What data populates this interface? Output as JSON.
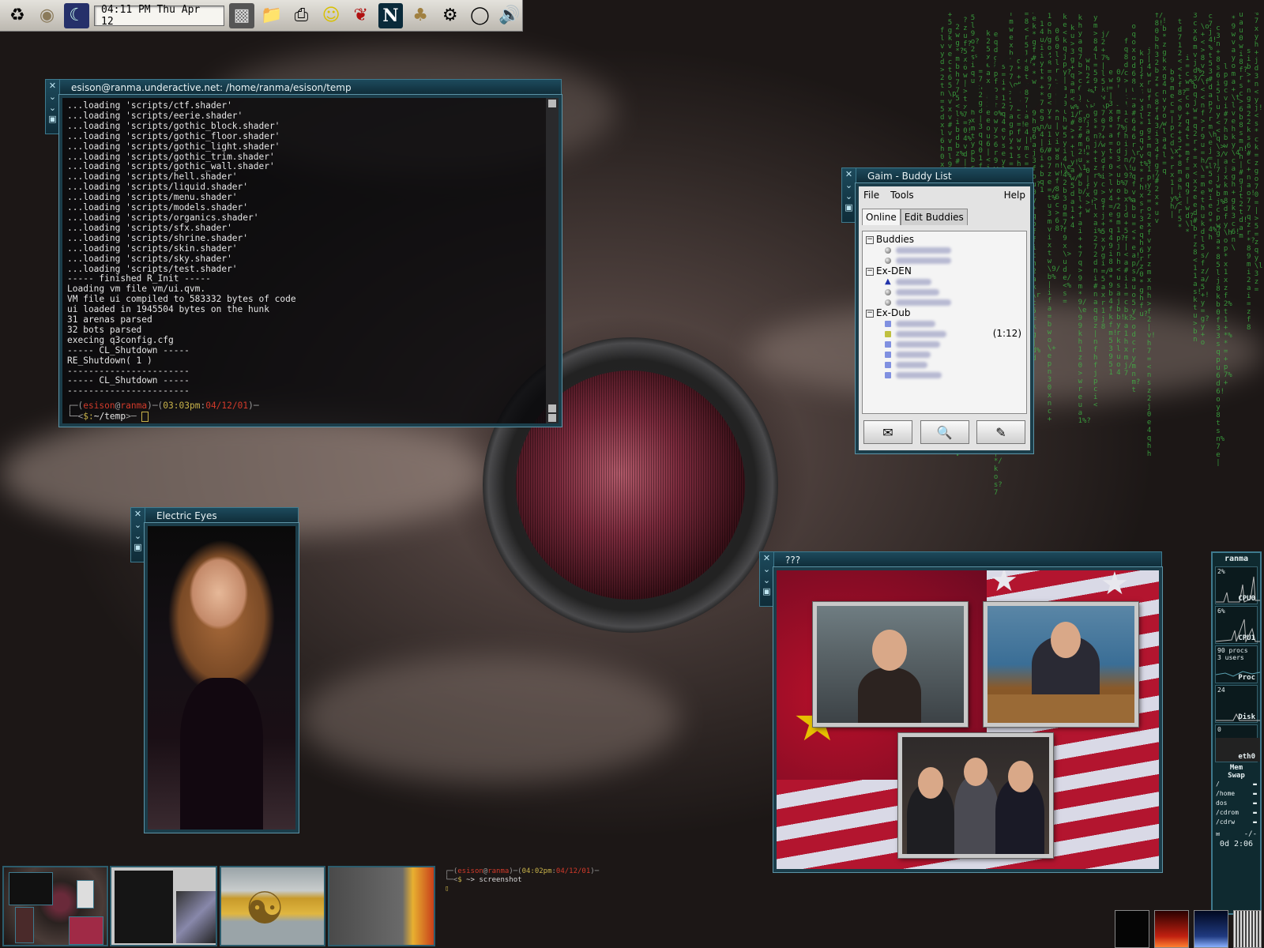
{
  "top_panel": {
    "clock": "04:11 PM Thu Apr 12",
    "icons": [
      "gnome-foot-icon",
      "gecko-icon",
      "display-settings-icon",
      "terminal-icon",
      "file-manager-icon",
      "printer-icon",
      "gnome-emblem-icon",
      "mozilla-icon",
      "netscape-icon",
      "wolf-icon",
      "mixer-icon",
      "cd-player-icon",
      "volume-icon"
    ]
  },
  "terminal": {
    "title": "esison@ranma.underactive.net: /home/ranma/esison/temp",
    "lines": [
      "...loading 'scripts/ctf.shader'",
      "...loading 'scripts/eerie.shader'",
      "...loading 'scripts/gothic_block.shader'",
      "...loading 'scripts/gothic_floor.shader'",
      "...loading 'scripts/gothic_light.shader'",
      "...loading 'scripts/gothic_trim.shader'",
      "...loading 'scripts/gothic_wall.shader'",
      "...loading 'scripts/hell.shader'",
      "...loading 'scripts/liquid.shader'",
      "...loading 'scripts/menu.shader'",
      "...loading 'scripts/models.shader'",
      "...loading 'scripts/organics.shader'",
      "...loading 'scripts/sfx.shader'",
      "...loading 'scripts/shrine.shader'",
      "...loading 'scripts/skin.shader'",
      "...loading 'scripts/sky.shader'",
      "...loading 'scripts/test.shader'",
      "----- finished R_Init -----",
      "Loading vm file vm/ui.qvm.",
      "VM file ui compiled to 583332 bytes of code",
      "ui loaded in 1945504 bytes on the hunk",
      "31 arenas parsed",
      "32 bots parsed",
      "execing q3config.cfg",
      "----- CL_Shutdown -----",
      "RE_Shutdown( 1 )",
      "-----------------------",
      "----- CL_Shutdown -----",
      "-----------------------"
    ],
    "prompt": {
      "user": "esison",
      "host": "ranma",
      "time": "03:03pm",
      "date": "04/12/01",
      "cwd": "~/temp"
    }
  },
  "gaim": {
    "title": "Gaim - Buddy List",
    "menu": {
      "file": "File",
      "tools": "Tools",
      "help": "Help"
    },
    "tabs": {
      "online": "Online",
      "edit": "Edit Buddies"
    },
    "groups": {
      "buddies": "Buddies",
      "exden": "Ex-DEN",
      "exdub": "Ex-Dub"
    },
    "idle": "(1:12)"
  },
  "eyes": {
    "title": "Electric Eyes"
  },
  "video": {
    "title": "???"
  },
  "monitor": {
    "host": "ranma",
    "cpu0_pct": "2%",
    "cpu0": "CPU0",
    "cpu1_pct": "6%",
    "cpu1": "CPU1",
    "procs": "90 procs",
    "users": "3 users",
    "proc": "Proc",
    "proc_val": "24",
    "disk": "Disk",
    "disk_val": "0",
    "net": "eth0",
    "mem": "Mem",
    "swap": "Swap",
    "fs": [
      "/",
      "/home",
      "dos",
      "/cdrom",
      "/cdrw"
    ],
    "mail": "-/-",
    "uptime": "0d 2:06"
  },
  "bottom_prompt": {
    "time": "04:02pm",
    "date": "04/12/01",
    "cmd": "screenshot"
  },
  "logo": {
    "top": "organic",
    "main": "noise"
  },
  "colors": {
    "accent": "#1d4a5c",
    "matrix": "#3fbf46",
    "prompt_red": "#d23a2a",
    "prompt_yellow": "#c8b24a"
  }
}
